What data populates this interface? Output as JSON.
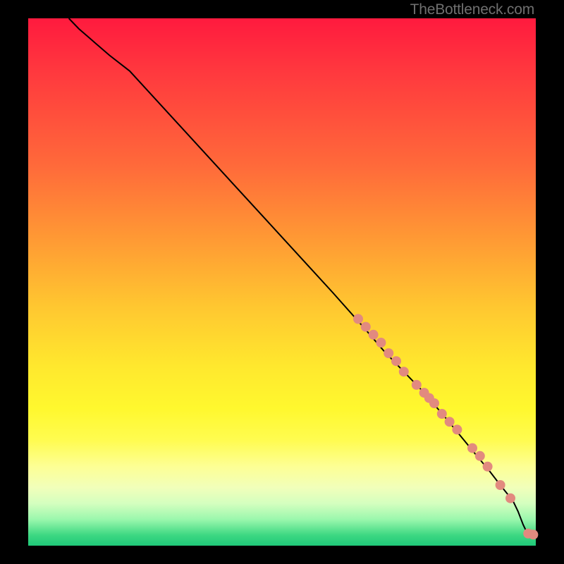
{
  "watermark": "TheBottleneck.com",
  "chart_data": {
    "type": "line",
    "title": "",
    "xlabel": "",
    "ylabel": "",
    "xlim": [
      0,
      100
    ],
    "ylim": [
      0,
      100
    ],
    "grid": false,
    "legend": false,
    "background": {
      "gradient_axis": "y",
      "stops": [
        {
          "value": 100,
          "color": "#ff1a3e"
        },
        {
          "value": 55,
          "color": "#ff9a34"
        },
        {
          "value": 30,
          "color": "#ffe82e"
        },
        {
          "value": 12,
          "color": "#f1ffba"
        },
        {
          "value": 0,
          "color": "#1fc979"
        }
      ]
    },
    "series": [
      {
        "name": "bottleneck-curve",
        "type": "line",
        "color": "#000000",
        "x": [
          8,
          10,
          13,
          16,
          20,
          30,
          40,
          50,
          60,
          66,
          70,
          74,
          78,
          82,
          85,
          88,
          91,
          93,
          95.5,
          96.5,
          97.5,
          98,
          98.5,
          99
        ],
        "y": [
          100,
          98,
          95.5,
          93,
          90,
          79.5,
          69,
          58.5,
          48,
          41.5,
          37,
          33,
          29,
          24.5,
          21,
          17.5,
          14,
          11.5,
          8.5,
          6.5,
          4,
          3,
          2.2,
          2
        ]
      },
      {
        "name": "marker-cluster",
        "type": "scatter",
        "color": "#e28a7f",
        "marker_radius": 7,
        "x": [
          65,
          66.5,
          68,
          69.5,
          71,
          72.5,
          74,
          76.5,
          78,
          79,
          80,
          81.5,
          83,
          84.5,
          87.5,
          89,
          90.5,
          93,
          95,
          98.5,
          99.5
        ],
        "y": [
          43,
          41.5,
          40,
          38.5,
          36.5,
          35,
          33,
          30.5,
          29,
          28,
          27,
          25,
          23.5,
          22,
          18.5,
          17,
          15,
          11.5,
          9,
          2.3,
          2.1
        ]
      }
    ]
  },
  "colors": {
    "curve": "#000000",
    "markers": "#e28a7f",
    "frame": "#000000",
    "watermark": "#6f6f6f"
  }
}
